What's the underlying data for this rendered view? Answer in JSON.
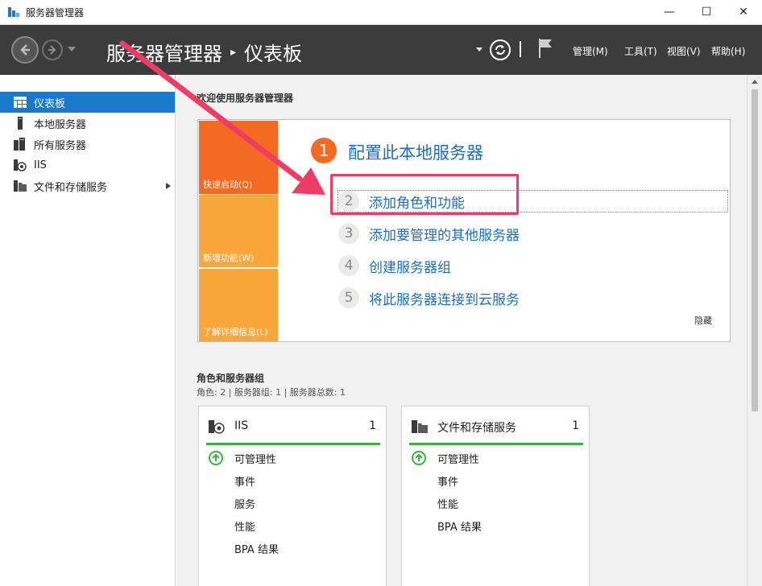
{
  "window": {
    "title": "服务器管理器",
    "minimize": "—",
    "maximize": "☐",
    "close": "✕"
  },
  "header": {
    "breadcrumb_root": "服务器管理器",
    "breadcrumb_sep": "▸",
    "breadcrumb_page": "仪表板",
    "menus": [
      {
        "label": "管理(M)"
      },
      {
        "label": "工具(T)"
      },
      {
        "label": "视图(V)"
      },
      {
        "label": "帮助(H)"
      }
    ]
  },
  "sidebar": {
    "items": [
      {
        "label": "仪表板",
        "icon": "dashboard-icon",
        "active": true
      },
      {
        "label": "本地服务器",
        "icon": "server-icon"
      },
      {
        "label": "所有服务器",
        "icon": "servers-icon"
      },
      {
        "label": "IIS",
        "icon": "iis-icon"
      },
      {
        "label": "文件和存储服务",
        "icon": "file-storage-icon",
        "has_submenu": true
      }
    ]
  },
  "welcome": {
    "title": "欢迎使用服务器管理器",
    "tiles": [
      {
        "label": "快速启动(Q)"
      },
      {
        "label": "新增功能(W)"
      },
      {
        "label": "了解详细信息(L)"
      }
    ],
    "step1_num": "1",
    "step1_label": "配置此本地服务器",
    "tasks": [
      {
        "num": "2",
        "label": "添加角色和功能"
      },
      {
        "num": "3",
        "label": "添加要管理的其他服务器"
      },
      {
        "num": "4",
        "label": "创建服务器组"
      },
      {
        "num": "5",
        "label": "将此服务器连接到云服务"
      }
    ],
    "hide": "隐藏"
  },
  "roles": {
    "title": "角色和服务器组",
    "summary": "角色: 2 | 服务器组: 1 | 服务器总数: 1",
    "tiles": [
      {
        "name": "IIS",
        "count": "1",
        "icon": "iis-icon",
        "rows": [
          "可管理性",
          "事件",
          "服务",
          "性能",
          "BPA 结果"
        ]
      },
      {
        "name": "文件和存储服务",
        "count": "1",
        "icon": "file-storage-icon",
        "rows": [
          "可管理性",
          "事件",
          "性能",
          "BPA 结果"
        ]
      }
    ]
  },
  "colors": {
    "accent": "#1979ca",
    "header_bg": "#3c3c3c",
    "quick_start": "#f36b22",
    "tile_orange": "#f9a63a",
    "link": "#1f6fb7",
    "status_green": "#3ab03e",
    "annotation": "#ee3c64"
  }
}
